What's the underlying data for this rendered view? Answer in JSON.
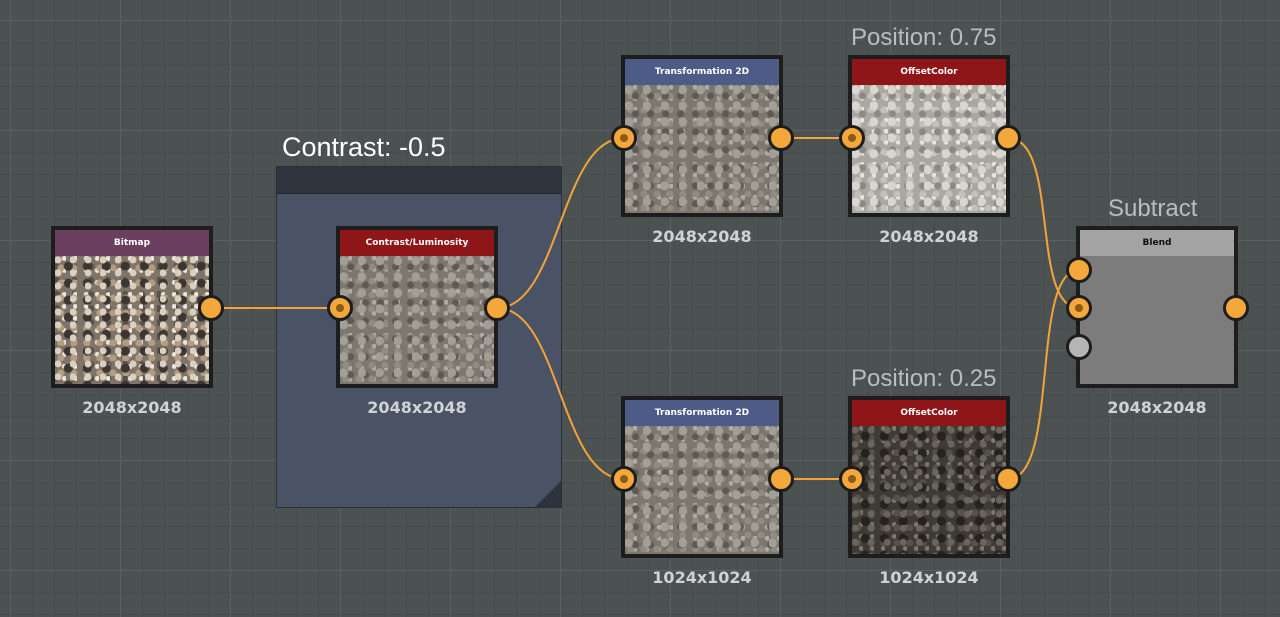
{
  "graph": {
    "frame": {
      "title": "Contrast: -0.5"
    },
    "comments": {
      "position_top": "Position: 0.75",
      "position_bottom": "Position: 0.25",
      "subtract": "Subtract"
    },
    "nodes": {
      "bitmap": {
        "title": "Bitmap",
        "resolution": "2048x2048"
      },
      "contrast": {
        "title": "Contrast/Luminosity",
        "resolution": "2048x2048"
      },
      "transform_top": {
        "title": "Transformation 2D",
        "resolution": "2048x2048"
      },
      "offset_top": {
        "title": "OffsetColor",
        "resolution": "2048x2048"
      },
      "transform_bottom": {
        "title": "Transformation 2D",
        "resolution": "1024x1024"
      },
      "offset_bottom": {
        "title": "OffsetColor",
        "resolution": "1024x1024"
      },
      "blend": {
        "title": "Blend",
        "resolution": "2048x2048"
      }
    }
  },
  "colors": {
    "wire": "#f2a33a",
    "port": "#f4a73a",
    "header_purple": "#6a3f60",
    "header_red": "#8e1518",
    "header_blue": "#4d5b87",
    "header_gray": "#a3a3a3",
    "frame_fill": "#4a5265",
    "canvas": "#4c5252"
  }
}
